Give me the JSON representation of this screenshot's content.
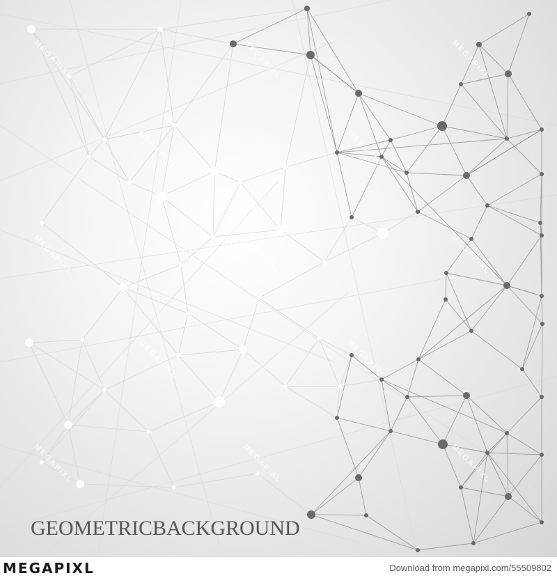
{
  "title": "GEOMETRICBACKGROUND",
  "watermark": "MEGAPIXL",
  "footer": {
    "brand": "MEGAPIXL",
    "download_text": "Download from megapixl.com/55509802"
  },
  "colors": {
    "node_dark": "#6a6a6a",
    "node_light": "#ffffff",
    "line_dark": "#8c8c8c",
    "line_light": "#d8d8d8",
    "title": "#555555"
  },
  "icons": [
    "network-graph"
  ]
}
